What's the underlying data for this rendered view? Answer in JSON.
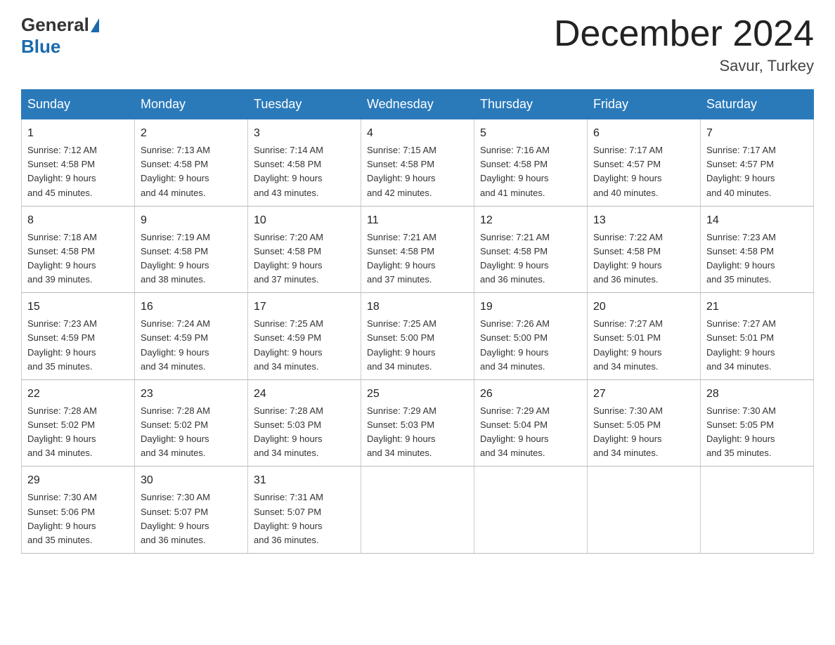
{
  "header": {
    "logo_general": "General",
    "logo_blue": "Blue",
    "month_title": "December 2024",
    "location": "Savur, Turkey"
  },
  "days_of_week": [
    "Sunday",
    "Monday",
    "Tuesday",
    "Wednesday",
    "Thursday",
    "Friday",
    "Saturday"
  ],
  "weeks": [
    [
      {
        "day": "1",
        "sunrise": "7:12 AM",
        "sunset": "4:58 PM",
        "daylight": "9 hours and 45 minutes."
      },
      {
        "day": "2",
        "sunrise": "7:13 AM",
        "sunset": "4:58 PM",
        "daylight": "9 hours and 44 minutes."
      },
      {
        "day": "3",
        "sunrise": "7:14 AM",
        "sunset": "4:58 PM",
        "daylight": "9 hours and 43 minutes."
      },
      {
        "day": "4",
        "sunrise": "7:15 AM",
        "sunset": "4:58 PM",
        "daylight": "9 hours and 42 minutes."
      },
      {
        "day": "5",
        "sunrise": "7:16 AM",
        "sunset": "4:58 PM",
        "daylight": "9 hours and 41 minutes."
      },
      {
        "day": "6",
        "sunrise": "7:17 AM",
        "sunset": "4:57 PM",
        "daylight": "9 hours and 40 minutes."
      },
      {
        "day": "7",
        "sunrise": "7:17 AM",
        "sunset": "4:57 PM",
        "daylight": "9 hours and 40 minutes."
      }
    ],
    [
      {
        "day": "8",
        "sunrise": "7:18 AM",
        "sunset": "4:58 PM",
        "daylight": "9 hours and 39 minutes."
      },
      {
        "day": "9",
        "sunrise": "7:19 AM",
        "sunset": "4:58 PM",
        "daylight": "9 hours and 38 minutes."
      },
      {
        "day": "10",
        "sunrise": "7:20 AM",
        "sunset": "4:58 PM",
        "daylight": "9 hours and 37 minutes."
      },
      {
        "day": "11",
        "sunrise": "7:21 AM",
        "sunset": "4:58 PM",
        "daylight": "9 hours and 37 minutes."
      },
      {
        "day": "12",
        "sunrise": "7:21 AM",
        "sunset": "4:58 PM",
        "daylight": "9 hours and 36 minutes."
      },
      {
        "day": "13",
        "sunrise": "7:22 AM",
        "sunset": "4:58 PM",
        "daylight": "9 hours and 36 minutes."
      },
      {
        "day": "14",
        "sunrise": "7:23 AM",
        "sunset": "4:58 PM",
        "daylight": "9 hours and 35 minutes."
      }
    ],
    [
      {
        "day": "15",
        "sunrise": "7:23 AM",
        "sunset": "4:59 PM",
        "daylight": "9 hours and 35 minutes."
      },
      {
        "day": "16",
        "sunrise": "7:24 AM",
        "sunset": "4:59 PM",
        "daylight": "9 hours and 34 minutes."
      },
      {
        "day": "17",
        "sunrise": "7:25 AM",
        "sunset": "4:59 PM",
        "daylight": "9 hours and 34 minutes."
      },
      {
        "day": "18",
        "sunrise": "7:25 AM",
        "sunset": "5:00 PM",
        "daylight": "9 hours and 34 minutes."
      },
      {
        "day": "19",
        "sunrise": "7:26 AM",
        "sunset": "5:00 PM",
        "daylight": "9 hours and 34 minutes."
      },
      {
        "day": "20",
        "sunrise": "7:27 AM",
        "sunset": "5:01 PM",
        "daylight": "9 hours and 34 minutes."
      },
      {
        "day": "21",
        "sunrise": "7:27 AM",
        "sunset": "5:01 PM",
        "daylight": "9 hours and 34 minutes."
      }
    ],
    [
      {
        "day": "22",
        "sunrise": "7:28 AM",
        "sunset": "5:02 PM",
        "daylight": "9 hours and 34 minutes."
      },
      {
        "day": "23",
        "sunrise": "7:28 AM",
        "sunset": "5:02 PM",
        "daylight": "9 hours and 34 minutes."
      },
      {
        "day": "24",
        "sunrise": "7:28 AM",
        "sunset": "5:03 PM",
        "daylight": "9 hours and 34 minutes."
      },
      {
        "day": "25",
        "sunrise": "7:29 AM",
        "sunset": "5:03 PM",
        "daylight": "9 hours and 34 minutes."
      },
      {
        "day": "26",
        "sunrise": "7:29 AM",
        "sunset": "5:04 PM",
        "daylight": "9 hours and 34 minutes."
      },
      {
        "day": "27",
        "sunrise": "7:30 AM",
        "sunset": "5:05 PM",
        "daylight": "9 hours and 34 minutes."
      },
      {
        "day": "28",
        "sunrise": "7:30 AM",
        "sunset": "5:05 PM",
        "daylight": "9 hours and 35 minutes."
      }
    ],
    [
      {
        "day": "29",
        "sunrise": "7:30 AM",
        "sunset": "5:06 PM",
        "daylight": "9 hours and 35 minutes."
      },
      {
        "day": "30",
        "sunrise": "7:30 AM",
        "sunset": "5:07 PM",
        "daylight": "9 hours and 36 minutes."
      },
      {
        "day": "31",
        "sunrise": "7:31 AM",
        "sunset": "5:07 PM",
        "daylight": "9 hours and 36 minutes."
      },
      null,
      null,
      null,
      null
    ]
  ]
}
